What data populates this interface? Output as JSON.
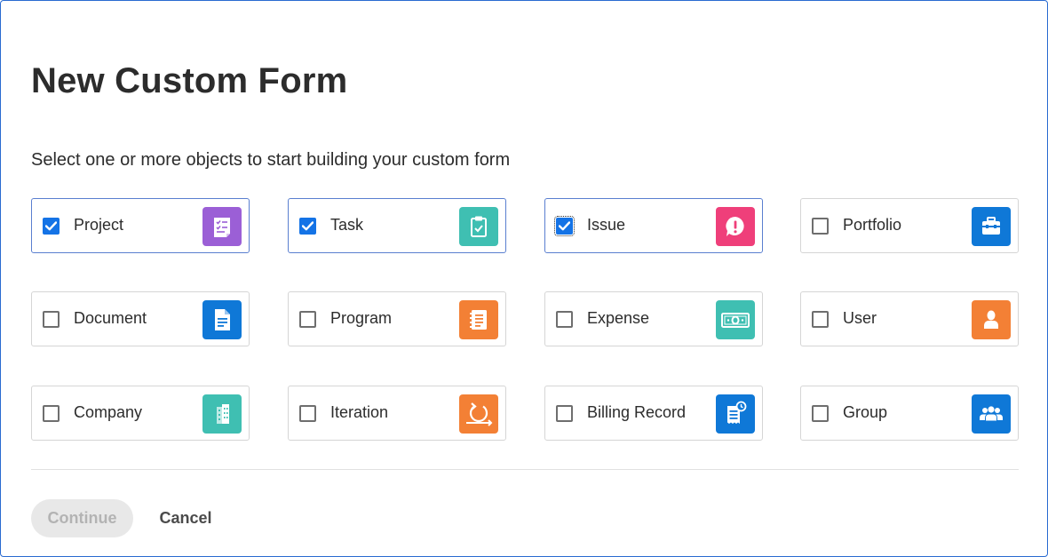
{
  "dialog": {
    "title": "New Custom Form",
    "subtitle": "Select one or more objects to start building your custom form"
  },
  "objects": [
    {
      "label": "Project",
      "checked": true,
      "icon": "project-icon",
      "color": "#9b5fd6"
    },
    {
      "label": "Task",
      "checked": true,
      "icon": "task-icon",
      "color": "#3fbfb2"
    },
    {
      "label": "Issue",
      "checked": true,
      "focused": true,
      "icon": "issue-icon",
      "color": "#ef3f7a"
    },
    {
      "label": "Portfolio",
      "checked": false,
      "icon": "portfolio-icon",
      "color": "#0f78d7"
    },
    {
      "label": "Document",
      "checked": false,
      "icon": "document-icon",
      "color": "#0f78d7"
    },
    {
      "label": "Program",
      "checked": false,
      "icon": "program-icon",
      "color": "#f38035"
    },
    {
      "label": "Expense",
      "checked": false,
      "icon": "expense-icon",
      "color": "#3fbfb2"
    },
    {
      "label": "User",
      "checked": false,
      "icon": "user-icon",
      "color": "#f38035"
    },
    {
      "label": "Company",
      "checked": false,
      "icon": "company-icon",
      "color": "#3fbfb2"
    },
    {
      "label": "Iteration",
      "checked": false,
      "icon": "iteration-icon",
      "color": "#f38035"
    },
    {
      "label": "Billing Record",
      "checked": false,
      "icon": "billing-record-icon",
      "color": "#0f78d7"
    },
    {
      "label": "Group",
      "checked": false,
      "icon": "group-icon",
      "color": "#0f78d7"
    }
  ],
  "footer": {
    "continue_label": "Continue",
    "cancel_label": "Cancel"
  },
  "colors": {
    "checkbox_checked": "#1473e6",
    "dialog_border": "#2a6bd1",
    "button_disabled_bg": "#e8e8e8"
  }
}
